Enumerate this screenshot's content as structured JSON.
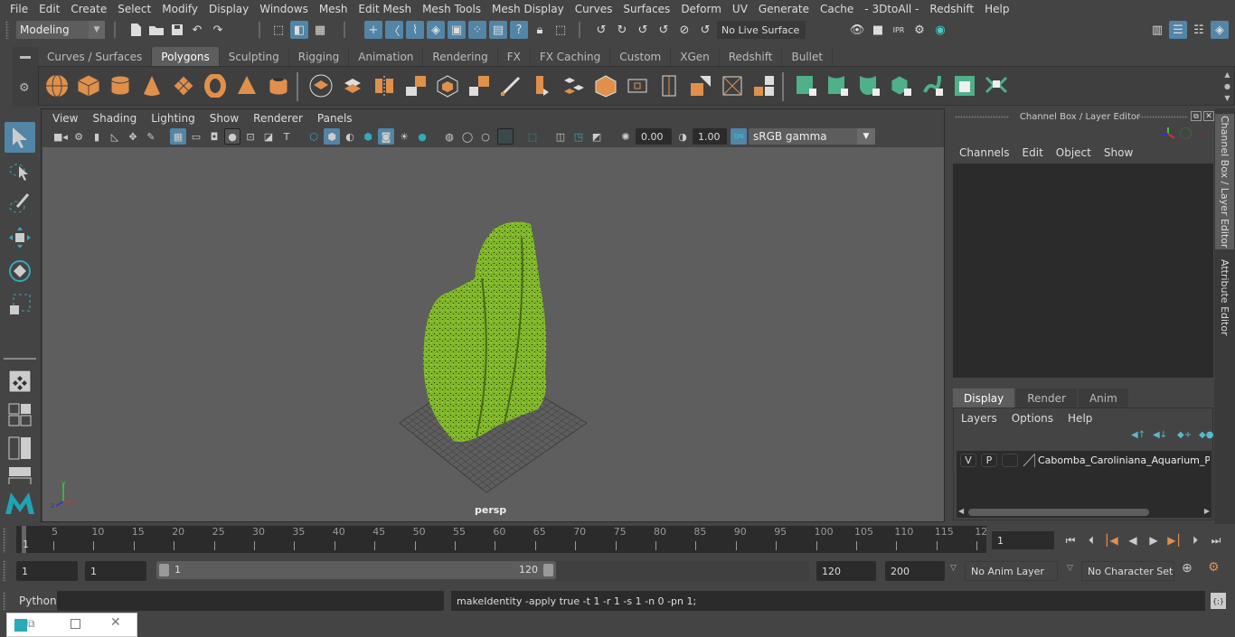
{
  "menubar": [
    "File",
    "Edit",
    "Create",
    "Select",
    "Modify",
    "Display",
    "Windows",
    "Mesh",
    "Edit Mesh",
    "Mesh Tools",
    "Mesh Display",
    "Curves",
    "Surfaces",
    "Deform",
    "UV",
    "Generate",
    "Cache",
    "- 3DtoAll -",
    "Redshift",
    "Help"
  ],
  "toolbar": {
    "workspace": "Modeling",
    "live_surface": "No Live Surface"
  },
  "shelf": {
    "tabs": [
      "Curves / Surfaces",
      "Polygons",
      "Sculpting",
      "Rigging",
      "Animation",
      "Rendering",
      "FX",
      "FX Caching",
      "Custom",
      "XGen",
      "Redshift",
      "Bullet"
    ],
    "active_tab": "Polygons"
  },
  "viewport": {
    "menu": [
      "View",
      "Shading",
      "Lighting",
      "Show",
      "Renderer",
      "Panels"
    ],
    "exposure": "0.00",
    "gamma": "1.00",
    "color_space": "sRGB gamma",
    "camera_label": "persp",
    "axis": {
      "x": "x",
      "y": "y",
      "z": "z"
    }
  },
  "channel_box": {
    "title": "Channel Box / Layer Editor",
    "menu": [
      "Channels",
      "Edit",
      "Object",
      "Show"
    ]
  },
  "layer_editor": {
    "tabs": [
      "Display",
      "Render",
      "Anim"
    ],
    "active_tab": "Display",
    "menu": [
      "Layers",
      "Options",
      "Help"
    ],
    "layers": [
      {
        "v": "V",
        "p": "P",
        "name": "Cabomba_Caroliniana_Aquarium_Pla"
      }
    ]
  },
  "side_tabs": [
    "Channel Box / Layer Editor",
    "Attribute Editor"
  ],
  "timeline": {
    "ticks": [
      "5",
      "10",
      "15",
      "20",
      "25",
      "30",
      "35",
      "40",
      "45",
      "50",
      "55",
      "60",
      "65",
      "70",
      "75",
      "80",
      "85",
      "90",
      "95",
      "100",
      "105",
      "110",
      "115",
      "12"
    ],
    "start_marker": "1",
    "current_frame": "1"
  },
  "range": {
    "start": "1",
    "playback_start": "1",
    "slider_start": "1",
    "slider_end": "120",
    "playback_end": "120",
    "end": "200",
    "anim_layer": "No Anim Layer",
    "character_set": "No Character Set"
  },
  "command_line": {
    "language": "Python",
    "input": "",
    "result": "makeIdentity -apply true -t 1 -r 1 -s 1 -n 0 -pn 1;"
  },
  "colors": {
    "accent": "#5285a6",
    "shelf_orange": "#e0904a",
    "shelf_green": "#4fb08a",
    "plant_green": "#7fb52a"
  }
}
